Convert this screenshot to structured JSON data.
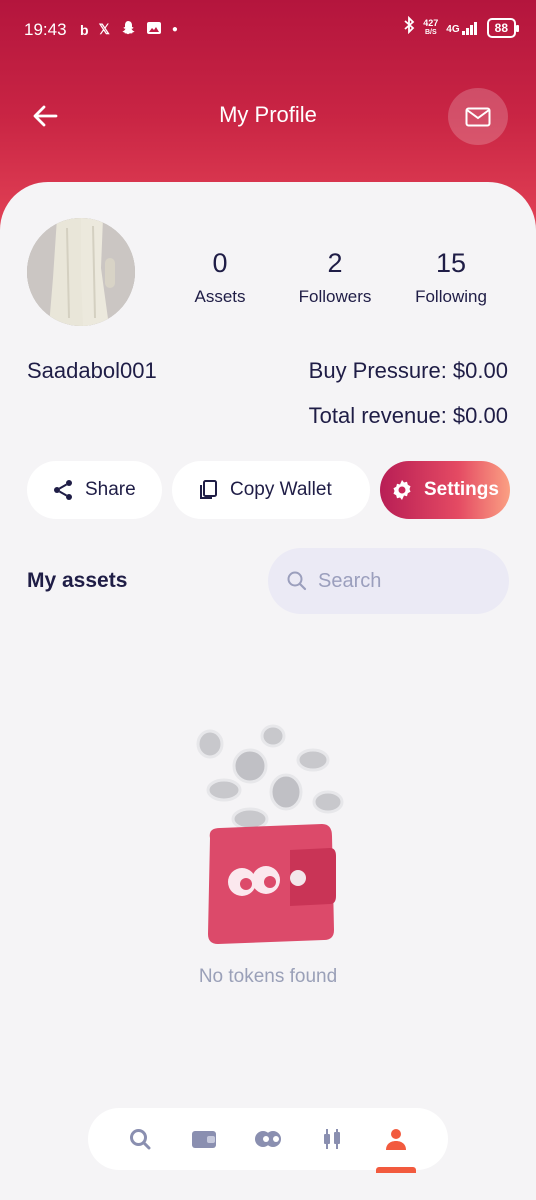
{
  "status_bar": {
    "time": "19:43",
    "net_speed_value": "427",
    "net_speed_unit": "B/S",
    "network": "4G",
    "battery": "88"
  },
  "header": {
    "title": "My Profile"
  },
  "profile": {
    "username": "Saadabol001",
    "stats": [
      {
        "value": "0",
        "label": "Assets"
      },
      {
        "value": "2",
        "label": "Followers"
      },
      {
        "value": "15",
        "label": "Following"
      }
    ],
    "buy_pressure": "Buy Pressure: $0.00",
    "total_revenue": "Total revenue: $0.00"
  },
  "actions": {
    "share_label": "Share",
    "copy_wallet_label": "Copy Wallet",
    "settings_label": "Settings"
  },
  "assets": {
    "title": "My assets",
    "search_placeholder": "Search",
    "empty_text": "No tokens found"
  },
  "bottom_nav": {
    "items": [
      "search-icon",
      "wallet-icon",
      "logo-icon",
      "chart-icon",
      "profile-icon"
    ],
    "active_index": 4
  },
  "colors": {
    "accent": "#f25a3e",
    "header_top": "#b4153d",
    "header_bottom": "#e9495a",
    "text_primary": "#1f1d46",
    "text_muted": "#9aa0b8"
  }
}
